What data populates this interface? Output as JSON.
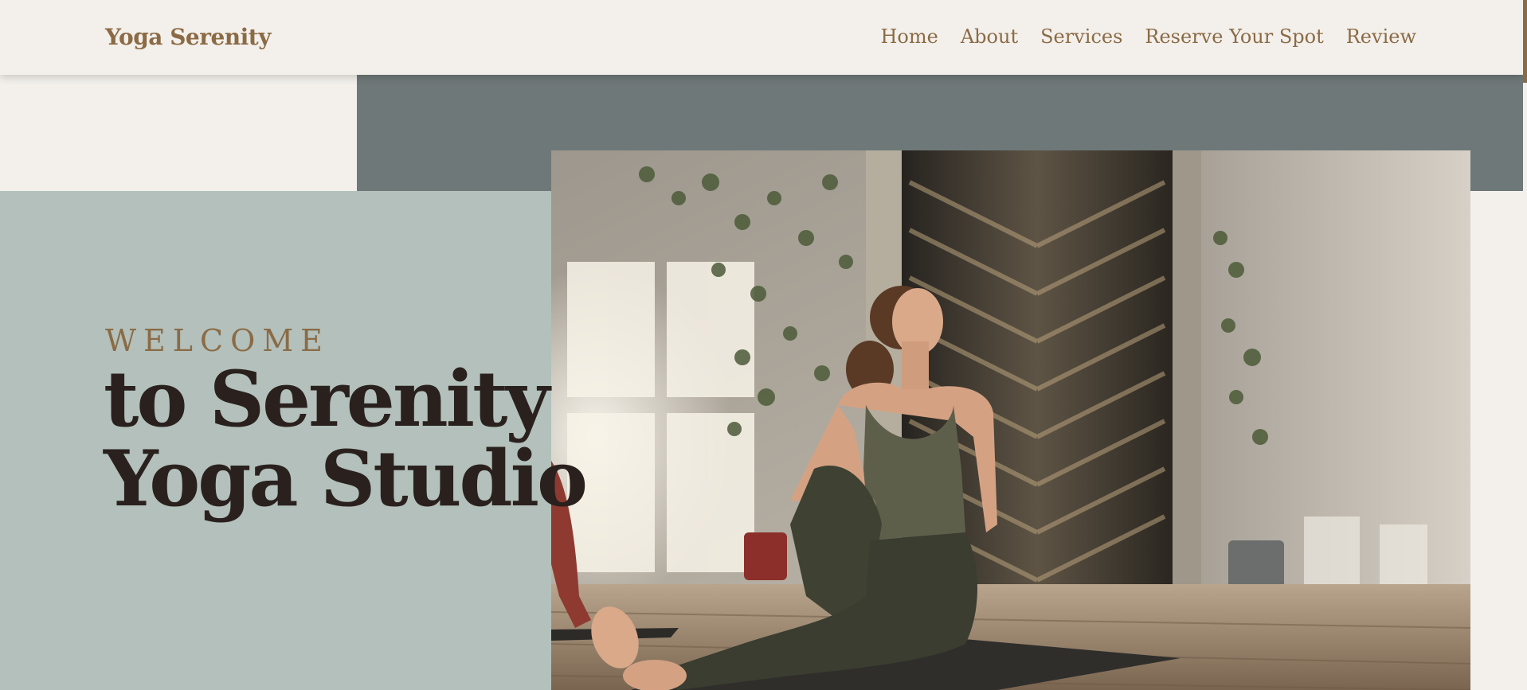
{
  "header": {
    "brand": "Yoga Serenity",
    "nav": [
      "Home",
      "About",
      "Services",
      "Reserve Your Spot",
      "Review"
    ]
  },
  "hero": {
    "eyebrow": "WELCOME",
    "title_line1": "to Serenity",
    "title_line2": "Yoga Studio",
    "image_alt": "Woman in olive activewear doing a seated spinal twist on a yoga mat in a sunlit studio"
  },
  "colors": {
    "brand": "#8b6b45",
    "background": "#f3f0ec",
    "slate_block": "#6f7878",
    "sage_block": "#b3c0bb",
    "title_text": "#2a211e"
  }
}
